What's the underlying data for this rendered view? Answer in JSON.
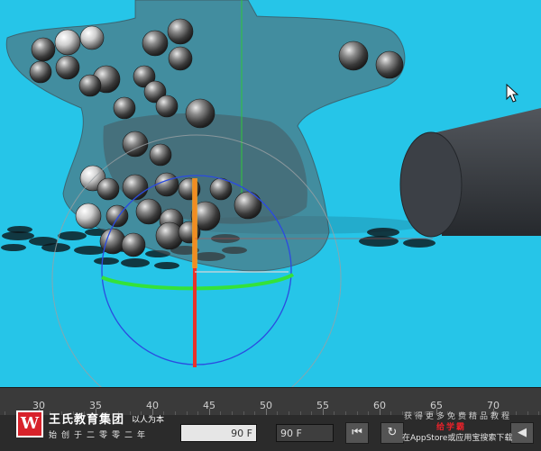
{
  "viewport": {
    "background": "#26c5e8",
    "emitter_fill": "#5a5e62",
    "gizmo_axis_vertical_color": "#e8322a",
    "gizmo_axis_horizontal_color": "#34e23a",
    "gizmo_circle_color": "#2b4be0",
    "cylinder_color": "#3c4046",
    "cursor_icon": "arrow-cursor-icon"
  },
  "timeline": {
    "ruler_labels": [
      "30",
      "35",
      "40",
      "45",
      "50",
      "55",
      "60",
      "65",
      "70"
    ],
    "start_frame": "90 F",
    "end_frame": "90 F",
    "buttons": {
      "go_to_start": "⏮",
      "play_reverse": "◀",
      "loop": "↻"
    }
  },
  "watermark": {
    "logo_letter": "W",
    "name": "王氏教育集团",
    "slogan": "以人为本",
    "subtitle": "始创于二零零二年"
  },
  "promo": {
    "line1": "获得更多免费精品教程",
    "brand": "给学霸",
    "line3": "在AppStore或应用宝搜索下载"
  }
}
